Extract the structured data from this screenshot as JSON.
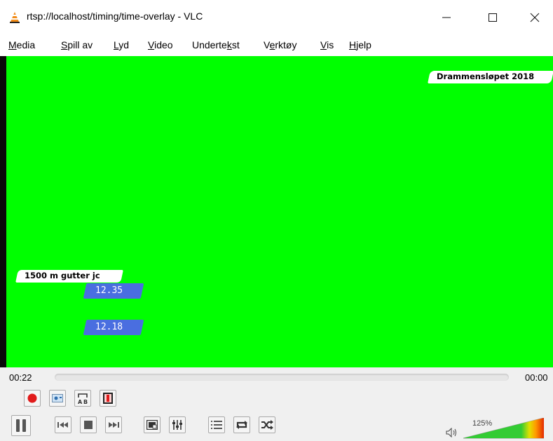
{
  "window": {
    "title": "rtsp://localhost/timing/time-overlay - VLC",
    "minimize_glyph": "—",
    "maximize_glyph": "☐",
    "close_glyph": "✕"
  },
  "menu": [
    {
      "accel": "M",
      "rest": "edia"
    },
    {
      "pre": "",
      "accel": "S",
      "rest": "pill av"
    },
    {
      "accel": "L",
      "rest": "yd"
    },
    {
      "accel": "V",
      "rest": "ideo"
    },
    {
      "pre": "Underte",
      "accel": "k",
      "rest": "st"
    },
    {
      "pre": "V",
      "accel": "e",
      "rest": "rktøy"
    },
    {
      "accel": "V",
      "rest": "is"
    },
    {
      "accel": "H",
      "rest": "jelp"
    }
  ],
  "overlay": {
    "event_name": "Drammensløpet 2018",
    "race_name": "1500 m gutter jc",
    "times": [
      "12.35",
      "12.18"
    ],
    "accent_color": "#4a6ee0",
    "background_color": "#00ff00"
  },
  "playback": {
    "elapsed": "00:22",
    "total": "00:00",
    "volume_label": "125%",
    "volume_level": 1.25
  },
  "icons": {
    "record": "record-icon",
    "snapshot": "snapshot-icon",
    "loop_ab": "loop-ab-icon",
    "frame_by_frame": "frame-by-frame-icon",
    "pause": "pause-icon",
    "previous": "previous-icon",
    "stop": "stop-icon",
    "next": "next-icon",
    "fullscreen": "fullscreen-icon",
    "extended_settings": "extended-settings-icon",
    "playlist": "playlist-icon",
    "loop": "loop-icon",
    "shuffle": "shuffle-icon",
    "volume": "speaker-icon"
  }
}
